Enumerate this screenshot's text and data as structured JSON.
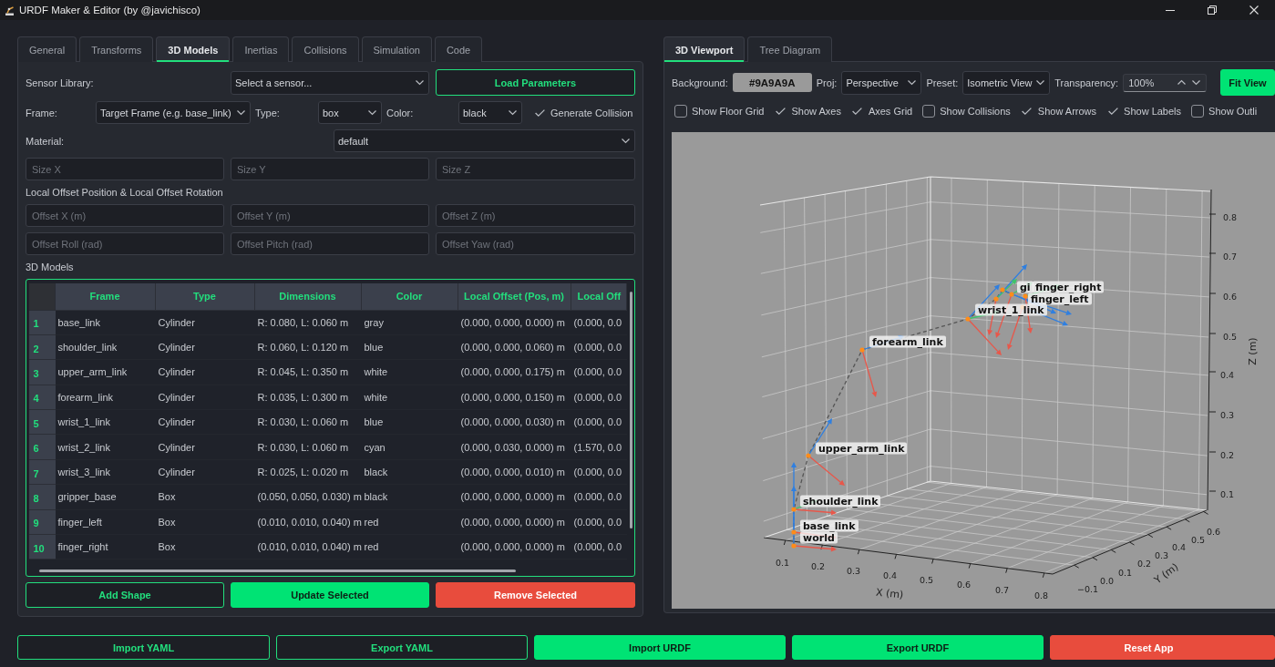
{
  "window": {
    "title": "URDF Maker & Editor (by @javichisco)"
  },
  "left_panel": {
    "tabs": [
      {
        "label": "General",
        "selected": false
      },
      {
        "label": "Transforms",
        "selected": false
      },
      {
        "label": "3D Models",
        "selected": true
      },
      {
        "label": "Inertias",
        "selected": false
      },
      {
        "label": "Collisions",
        "selected": false
      },
      {
        "label": "Simulation",
        "selected": false
      },
      {
        "label": "Code",
        "selected": false
      }
    ],
    "sensor_library": {
      "label": "Sensor Library:",
      "value": "Select a sensor..."
    },
    "load_button": {
      "label": "Load Parameters",
      "kind": "outline"
    },
    "frame": {
      "label": "Frame:",
      "value": "Target Frame (e.g. base_link)"
    },
    "type": {
      "label": "Type:",
      "value": "box"
    },
    "color": {
      "label": "Color:",
      "value": "black"
    },
    "generate_collision": {
      "label": "Generate Collision",
      "checked": true
    },
    "material": {
      "label": "Material:",
      "value": "default"
    },
    "size_fields": [
      {
        "placeholder": "Size X"
      },
      {
        "placeholder": "Size Y"
      },
      {
        "placeholder": "Size Z"
      }
    ],
    "offset_heading": "Local Offset Position & Local Offset Rotation",
    "offset_fields": [
      {
        "placeholder": "Offset X (m)"
      },
      {
        "placeholder": "Offset Y (m)"
      },
      {
        "placeholder": "Offset Z (m)"
      },
      {
        "placeholder": "Offset Roll (rad)"
      },
      {
        "placeholder": "Offset Pitch (rad)"
      },
      {
        "placeholder": "Offset Yaw (rad)"
      }
    ],
    "models_heading": "3D Models",
    "table": {
      "columns": [
        "Frame",
        "Type",
        "Dimensions",
        "Color",
        "Local Offset (Pos, m)",
        "Local Off"
      ],
      "rows": [
        {
          "number": "1",
          "cells": [
            "base_link",
            "Cylinder",
            "R: 0.080, L: 0.060 m",
            "gray",
            "(0.000, 0.000, 0.000) m",
            "(0.000, 0.0"
          ]
        },
        {
          "number": "2",
          "cells": [
            "shoulder_link",
            "Cylinder",
            "R: 0.060, L: 0.120 m",
            "blue",
            "(0.000, 0.000, 0.060) m",
            "(0.000, 0.0"
          ]
        },
        {
          "number": "3",
          "cells": [
            "upper_arm_link",
            "Cylinder",
            "R: 0.045, L: 0.350 m",
            "white",
            "(0.000, 0.000, 0.175) m",
            "(0.000, 0.0"
          ]
        },
        {
          "number": "4",
          "cells": [
            "forearm_link",
            "Cylinder",
            "R: 0.035, L: 0.300 m",
            "white",
            "(0.000, 0.000, 0.150) m",
            "(0.000, 0.0"
          ]
        },
        {
          "number": "5",
          "cells": [
            "wrist_1_link",
            "Cylinder",
            "R: 0.030, L: 0.060 m",
            "blue",
            "(0.000, 0.000, 0.030) m",
            "(0.000, 0.0"
          ]
        },
        {
          "number": "6",
          "cells": [
            "wrist_2_link",
            "Cylinder",
            "R: 0.030, L: 0.060 m",
            "cyan",
            "(0.000, 0.030, 0.000) m",
            "(1.570, 0.0"
          ]
        },
        {
          "number": "7",
          "cells": [
            "wrist_3_link",
            "Cylinder",
            "R: 0.025, L: 0.020 m",
            "black",
            "(0.000, 0.000, 0.010) m",
            "(0.000, 0.0"
          ]
        },
        {
          "number": "8",
          "cells": [
            "gripper_base",
            "Box",
            "(0.050, 0.050, 0.030) m",
            "black",
            "(0.000, 0.000, 0.000) m",
            "(0.000, 0.0"
          ]
        },
        {
          "number": "9",
          "cells": [
            "finger_left",
            "Box",
            "(0.010, 0.010, 0.040) m",
            "red",
            "(0.000, 0.000, 0.000) m",
            "(0.000, 0.0"
          ]
        },
        {
          "number": "10",
          "cells": [
            "finger_right",
            "Box",
            "(0.010, 0.010, 0.040) m",
            "red",
            "(0.000, 0.000, 0.000) m",
            "(0.000, 0.0"
          ]
        }
      ]
    },
    "buttons": [
      {
        "label": "Add Shape",
        "kind": "outline"
      },
      {
        "label": "Update Selected",
        "kind": "primary"
      },
      {
        "label": "Remove Selected",
        "kind": "danger"
      }
    ]
  },
  "right_panel": {
    "tabs": [
      {
        "label": "3D Viewport",
        "selected": true
      },
      {
        "label": "Tree Diagram",
        "selected": false
      }
    ],
    "background": {
      "label": "Background:",
      "value": "#9A9A9A"
    },
    "projection": {
      "label": "Proj:",
      "value": "Perspective"
    },
    "preset": {
      "label": "Preset:",
      "value": "Isometric View"
    },
    "transparency": {
      "label": "Transparency:",
      "value": "100%"
    },
    "fit_button": {
      "label": "Fit View",
      "kind": "primary"
    },
    "toggles": [
      {
        "label": "Show Floor Grid",
        "checked": false
      },
      {
        "label": "Show Axes",
        "checked": true
      },
      {
        "label": "Axes Grid",
        "checked": true
      },
      {
        "label": "Show Collisions",
        "checked": false
      },
      {
        "label": "Show Arrows",
        "checked": true
      },
      {
        "label": "Show Labels",
        "checked": true
      },
      {
        "label": "Show Outli",
        "checked": false
      }
    ],
    "plot": {
      "z_ticks": [
        "0.8",
        "0.7",
        "0.6",
        "0.5",
        "0.4",
        "0.3",
        "0.2",
        "0.1"
      ],
      "z_label": "Z (m)",
      "x_ticks": [
        "0.1",
        "0.2",
        "0.3",
        "0.4",
        "0.5",
        "0.6",
        "0.7",
        "0.8"
      ],
      "x_label": "X (m)",
      "y_ticks": [
        "−0.1",
        "0.0",
        "0.1",
        "0.2",
        "0.3",
        "0.4",
        "0.5",
        "0.6"
      ],
      "y_label": "Y (m)",
      "link_labels": [
        "gi",
        "finger_right",
        "finger_left",
        "wrist_1_link",
        "forearm_link",
        "upper_arm_link",
        "shoulder_link",
        "base_link",
        "world"
      ]
    }
  },
  "footer_buttons": [
    {
      "label": "Import YAML",
      "kind": "outline"
    },
    {
      "label": "Export YAML",
      "kind": "outline"
    },
    {
      "label": "Import URDF",
      "kind": "primary"
    },
    {
      "label": "Export URDF",
      "kind": "primary"
    },
    {
      "label": "Reset App",
      "kind": "danger"
    }
  ]
}
